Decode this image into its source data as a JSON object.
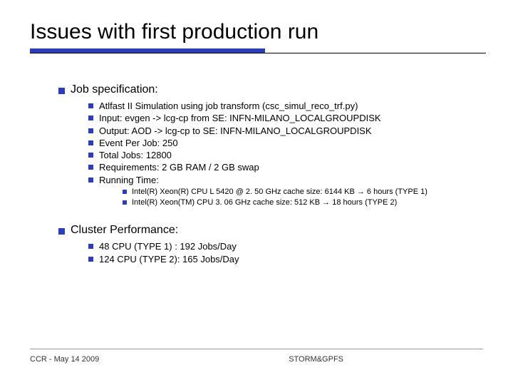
{
  "title": "Issues with first production run",
  "sections": [
    {
      "heading": "Job specification:",
      "items": [
        "Atlfast II Simulation using job transform (csc_simul_reco_trf.py)",
        "Input: evgen -> lcg-cp from SE: INFN-MILANO_LOCALGROUPDISK",
        "Output: AOD -> lcg-cp to SE: INFN-MILANO_LOCALGROUPDISK",
        "Event Per Job: 250",
        "Total Jobs: 12800",
        "Requirements: 2 GB RAM / 2 GB swap",
        "Running Time:"
      ],
      "subitems": [
        "Intel(R) Xeon(R) CPU L 5420 @ 2. 50 GHz cache size: 6144 KB → 6 hours (TYPE 1)",
        "Intel(R) Xeon(TM) CPU 3. 06 GHz cache size: 512 KB → 18 hours (TYPE 2)"
      ]
    },
    {
      "heading": "Cluster Performance:",
      "items": [
        "48 CPU (TYPE 1) : 192 Jobs/Day",
        "124 CPU (TYPE 2): 165 Jobs/Day"
      ]
    }
  ],
  "footer": {
    "left": "CCR - May 14 2009",
    "center": "STORM&GPFS"
  }
}
